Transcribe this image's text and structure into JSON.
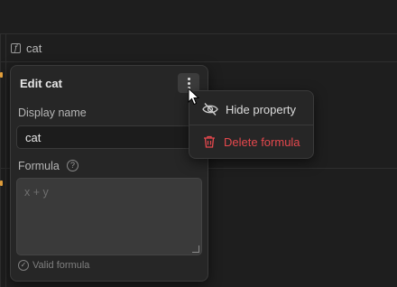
{
  "column": {
    "name": "cat",
    "icon": "formula-icon"
  },
  "panel": {
    "title": "Edit cat",
    "display_name_label": "Display name",
    "display_name_value": "cat",
    "formula_label": "Formula",
    "formula_help": "?",
    "formula_placeholder": "x + y",
    "status_text": "Valid formula"
  },
  "menu": {
    "items": [
      {
        "label": "Hide property",
        "icon": "eye-off-icon"
      },
      {
        "label": "Delete formula",
        "icon": "trash-icon",
        "color": "#e5484d"
      }
    ]
  },
  "colors": {
    "background": "#1e1e1e",
    "panel": "#262626",
    "danger": "#e5484d",
    "edge_accent": "#e8a33d"
  }
}
